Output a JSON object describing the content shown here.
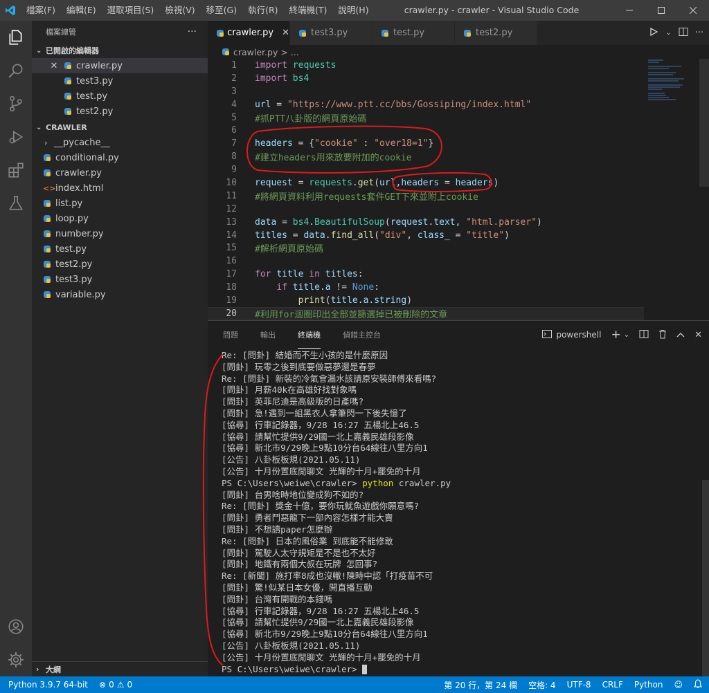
{
  "window": {
    "title": "crawler.py - crawler - Visual Studio Code",
    "menu": [
      "檔案(F)",
      "編輯(E)",
      "選取項目(S)",
      "檢視(V)",
      "移至(G)",
      "執行(R)",
      "終端機(T)",
      "說明(H)"
    ]
  },
  "sidebar": {
    "title": "檔案總管",
    "open_editors_label": "已開啟的編輯器",
    "open_editors": [
      "crawler.py",
      "test3.py",
      "test.py",
      "test2.py"
    ],
    "folder_label": "CRAWLER",
    "files": [
      {
        "name": "__pycache__",
        "type": "folder"
      },
      {
        "name": "conditional.py",
        "type": "py"
      },
      {
        "name": "crawler.py",
        "type": "py"
      },
      {
        "name": "index.html",
        "type": "html"
      },
      {
        "name": "list.py",
        "type": "py"
      },
      {
        "name": "loop.py",
        "type": "py"
      },
      {
        "name": "number.py",
        "type": "py"
      },
      {
        "name": "test.py",
        "type": "py"
      },
      {
        "name": "test2.py",
        "type": "py"
      },
      {
        "name": "test3.py",
        "type": "py"
      },
      {
        "name": "variable.py",
        "type": "py"
      }
    ],
    "outline_label": "大綱"
  },
  "tabs": [
    "crawler.py",
    "test3.py",
    "test.py",
    "test2.py"
  ],
  "breadcrumb": {
    "file": "crawler.py",
    "sep": ">",
    "rest": "..."
  },
  "editor": {
    "line_numbers": [
      "1",
      "2",
      "3",
      "4",
      "5",
      "6",
      "7",
      "8",
      "9",
      "10",
      "11",
      "12",
      "13",
      "14",
      "15",
      "16",
      "17",
      "18",
      "19",
      "20"
    ],
    "l1_kw": "import",
    "l1_mod": "requests",
    "l2_kw": "import",
    "l2_mod": "bs4",
    "l4_var": "url",
    "l4_eq": " = ",
    "l4_str": "\"https://www.ptt.cc/bbs/Gossiping/index.html\"",
    "l5_cm": "#抓PTT八卦版的網頁原始碼",
    "l7_var": "headers",
    "l7_eq": " = {",
    "l7_k": "\"cookie\"",
    "l7_colon": " : ",
    "l7_v": "\"over18=1\"",
    "l7_end": "}",
    "l8_cm": "#建立headers用來放要附加的cookie",
    "l10_var": "request",
    "l10_eq": " = ",
    "l10_mod": "requests",
    "l10_dot": ".",
    "l10_fn": "get",
    "l10_p1": "(",
    "l10_a1": "url",
    "l10_c": ",",
    "l10_a2": "headers",
    "l10_eq2": " = ",
    "l10_a3": "headers",
    "l10_p2": ")",
    "l11_cm": "#將網頁資料利用requests套件GET下來並附上cookie",
    "l13_var": "data",
    "l13_eq": " = ",
    "l13_mod": "bs4",
    "l13_dot": ".",
    "l13_cls": "BeautifulSoup",
    "l13_p1": "(",
    "l13_a1": "request",
    "l13_dot2": ".",
    "l13_a2": "text",
    "l13_c": ", ",
    "l13_str": "\"html.parser\"",
    "l13_p2": ")",
    "l14_var": "titles",
    "l14_eq": " = ",
    "l14_a1": "data",
    "l14_dot": ".",
    "l14_fn": "find_all",
    "l14_p1": "(",
    "l14_str": "\"div\"",
    "l14_c": ", ",
    "l14_a2": "class_",
    "l14_eq2": " = ",
    "l14_str2": "\"title\"",
    "l14_p2": ")",
    "l15_cm": "#解析網頁原始碼",
    "l17_kw": "for",
    "l17_v1": "title",
    "l17_in": "in",
    "l17_v2": "titles",
    "l17_end": ":",
    "l18_kw": "if",
    "l18_v1": "title",
    "l18_dot": ".",
    "l18_v2": "a",
    "l18_op": " != ",
    "l18_none": "None",
    "l18_end": ":",
    "l19_fn": "print",
    "l19_p1": "(",
    "l19_v1": "title",
    "l19_dot": ".",
    "l19_v2": "a",
    "l19_dot2": ".",
    "l19_v3": "string",
    "l19_p2": ")",
    "l20_cm": "#利用for迴圈印出全部並篩選掉已被刪除的文章"
  },
  "panel": {
    "tabs": [
      "問題",
      "輸出",
      "終端機",
      "偵錯主控台"
    ],
    "shell": "powershell",
    "terminal_lines": [
      "Re: [問卦] 結婚而不生小孩的是什麼原因",
      "[問卦] 玩零之後到底要做惡夢還是春夢",
      "Re: [問卦] 新裝的冷氣會漏水該請原安裝師傅來看嗎?",
      "[問卦] 月薪40k在高雄好找對象嗎",
      "[問卦] 英菲尼迪是高級版的日產嗎?",
      "[問卦] 急!遇到一組黑衣人拿筆閃一下後失憶了",
      "[協尋] 行車記錄器，9/28 16:27 五楊北上46.5",
      "[協尋] 請幫忙提供9/29國一北上嘉義民雄段影像",
      "[協尋] 新北市9/29晚上9點10分台64線往八里方向1",
      "[公告] 八卦板板規(2021.05.11)",
      "[公告] 十月份置底閒聊文 光輝的十月+罷免的十月"
    ],
    "prompt": "PS C:\\Users\\weiwe\\crawler> ",
    "command_py": "python",
    "command_rest": " crawler.py",
    "terminal_lines2": [
      "[問卦] 台男啥時地位變成狗不如的?",
      "Re: [問卦] 獎金十億，要你玩魷魚遊戲你願意嗎?",
      "[問卦] 勇者鬥惡龍下一部內容怎樣才能大賣",
      "[問卦] 不想讀paper怎麼辦",
      "Re: [問卦] 日本的風俗業 到底能不能修敢",
      "[問卦] 駕駛人太守規矩是不是也不太好",
      "[問卦] 地鐵有兩個大叔在玩牌 怎回事?",
      "Re: [新聞] 施打率8成也沒轍!陳時中認「打疫苗不可",
      "[問卦] 驚!似某日本女優，開直播互動",
      "[問卦] 台灣有開戰的本錢嗎",
      "[協尋] 行車記錄器，9/28 16:27 五楊北上46.5",
      "[協尋] 請幫忙提供9/29國一北上嘉義民雄段影像",
      "[協尋] 新北市9/29晚上9點10分台64線往八里方向1",
      "[公告] 八卦板板規(2021.05.11)",
      "[公告] 十月份置底閒聊文 光輝的十月+罷免的十月"
    ],
    "final_prompt": "PS C:\\Users\\weiwe\\crawler> "
  },
  "statusbar": {
    "interpreter": "Python 3.9.7 64-bit",
    "errors": "0",
    "warnings": "0",
    "position": "第 20 行，第 24 欄",
    "spaces": "空格: 4",
    "encoding": "UTF-8",
    "eol": "CRLF",
    "language": "Python"
  },
  "colors": {
    "accent": "#007acc",
    "annotation": "#e0191b"
  }
}
